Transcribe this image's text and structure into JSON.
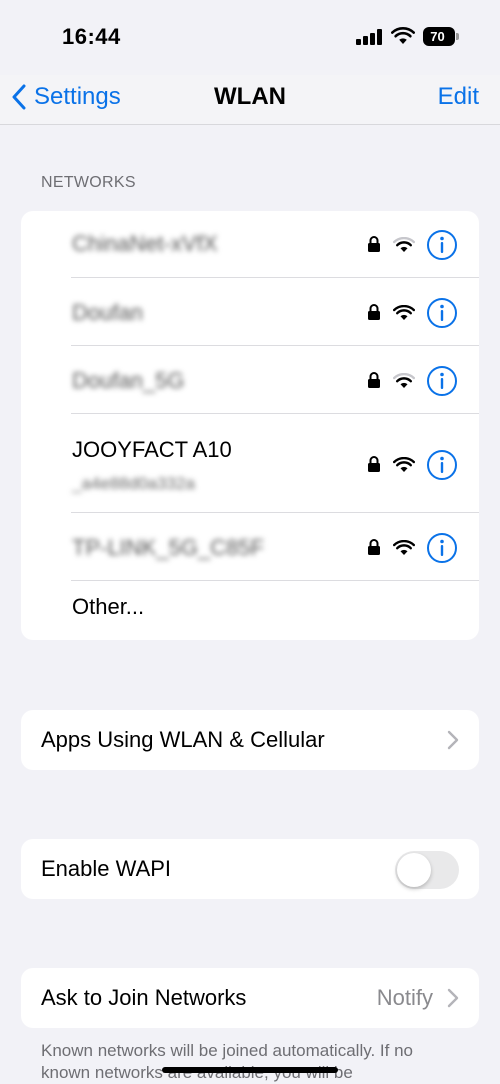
{
  "status_bar": {
    "time": "16:44",
    "battery_percent": "70"
  },
  "nav": {
    "back_label": "Settings",
    "title": "WLAN",
    "edit_label": "Edit"
  },
  "networks": {
    "header": "NETWORKS",
    "items": [
      {
        "name": "ChinaNet-xVfX",
        "subtitle": "",
        "blurred": true,
        "secured": true,
        "signal": "medium"
      },
      {
        "name": "Doufan",
        "subtitle": "",
        "blurred": true,
        "secured": true,
        "signal": "full"
      },
      {
        "name": "Doufan_5G",
        "subtitle": "",
        "blurred": true,
        "secured": true,
        "signal": "medium"
      },
      {
        "name": "JOOYFACT A10",
        "subtitle": "_a4e88d0a332a",
        "blurred": false,
        "secured": true,
        "signal": "full"
      },
      {
        "name": "TP-LINK_5G_C85F",
        "subtitle": "",
        "blurred": true,
        "secured": true,
        "signal": "full"
      }
    ],
    "other_label": "Other..."
  },
  "apps_row": {
    "label": "Apps Using WLAN & Cellular"
  },
  "wapi_row": {
    "label": "Enable WAPI",
    "enabled": false
  },
  "ask_join_row": {
    "label": "Ask to Join Networks",
    "value": "Notify"
  },
  "footer_note": "Known networks will be joined automatically. If no known networks are available, you will be",
  "colors": {
    "accent": "#0a72e8",
    "background": "#f2f2f7",
    "secondary_text": "#6e6e73"
  },
  "icons": [
    "back-chevron-icon",
    "cellular-signal-icon",
    "wifi-icon",
    "battery-icon",
    "lock-icon",
    "info-icon",
    "chevron-right-icon"
  ]
}
